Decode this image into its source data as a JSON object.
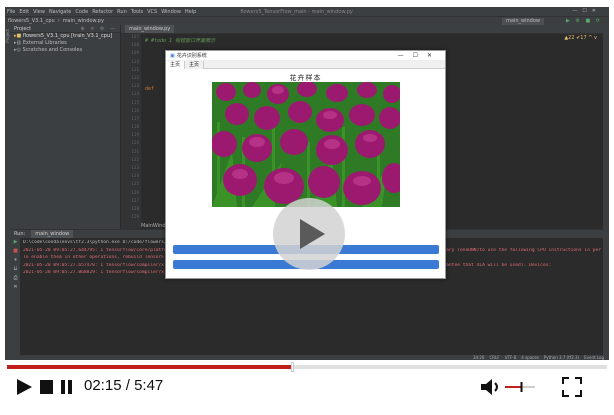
{
  "ide": {
    "menu": [
      "File",
      "Edit",
      "View",
      "Navigate",
      "Code",
      "Refactor",
      "Run",
      "Tools",
      "VCS",
      "Window",
      "Help"
    ],
    "window_title": "flowers5_TensorFlow_main - main_window.py",
    "breadcrumb": [
      "flowers5_V3.1_cpu",
      "main_window.py"
    ],
    "run_config": "main_window",
    "project_label": "Project",
    "project_tree": [
      "flowers5_V3.1_cpu [train_V3.1_cpu]",
      "External Libraries",
      "Scratches and Consoles"
    ],
    "editor_tab": "main_window.py",
    "line_numbers": [
      "107",
      "108",
      "109",
      "110",
      "111",
      "112",
      "113",
      "114",
      "115",
      "116",
      "117",
      "118",
      "119",
      "120",
      "121",
      "122",
      "123",
      "124",
      "125",
      "126",
      "127",
      "128",
      "129"
    ],
    "code_lines": [
      {
        "text": "# #todo 1 按钮窗口界面展示",
        "cls": "comment"
      },
      {
        "text": "",
        "cls": ""
      },
      {
        "text": "",
        "cls": ""
      },
      {
        "text": "",
        "cls": ""
      },
      {
        "text": "",
        "cls": ""
      },
      {
        "text": "",
        "cls": ""
      },
      {
        "text": "def",
        "cls": "kw"
      }
    ],
    "editor_footer": "MainWindow",
    "inspection_marks": "▲22 ✔17 ^ v",
    "run_label": "Run:",
    "run_tab": "main_window",
    "console_lines": [
      {
        "text": "D:\\code\\condalenvs\\tf2.3\\python.exe D:/code/flowers/flowers5_TensorFlow/main_window.py",
        "cls": "w"
      },
      {
        "text": "2021-05-28 09:05:27.644795: I tensorflow/core/platform/cpu_feature_guard.cc:142] This TensorFlow binary is optimized with oneAPI Deep Neural Network Library (oneDNN)to use the following CPU instructions in performance-critical operations:  AVX2",
        "cls": "r"
      },
      {
        "text": "To enable them in other operations, rebuild TensorFlow with the appropriate compiler flags.",
        "cls": "r"
      },
      {
        "text": "2021-05-28 09:05:27.657478: I tensorflow/compiler/xla/service/service.cc:168] XLA service 0x1f6b0d3f0f0 initialized for platform Host (this does not guarantee that XLA will be used). Devices:",
        "cls": "r"
      },
      {
        "text": "2021-05-28 09:05:27.868829: I tensorflow/compiler/xla/service/service.cc:176]   StreamExecutor device (0): Host, Default Version",
        "cls": "r"
      }
    ],
    "bottom_tabs": [
      "4: Run",
      "6: TODO",
      "6: Problems",
      "Terminal",
      "Python Console"
    ],
    "status_items": [
      "34:26",
      "CRLF",
      "UTF-8",
      "4 spaces",
      "Python 3.7 (tf2.3)",
      "Event Log"
    ]
  },
  "app": {
    "title": "花卉识别系统",
    "tabs": [
      "主页",
      "主页"
    ],
    "heading": "花卉样本"
  },
  "player": {
    "current_time": "02:15",
    "separator": " / ",
    "total_time": "5:47",
    "progress": 0.475,
    "volume": 0.55,
    "accent": "#c0201c"
  }
}
